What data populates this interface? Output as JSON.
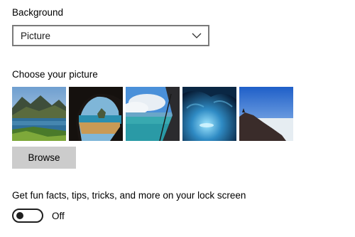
{
  "background": {
    "label": "Background",
    "selected": "Picture"
  },
  "picture_chooser": {
    "label": "Choose your picture",
    "thumbnails": [
      {
        "name": "mountain-lake"
      },
      {
        "name": "beach-cave"
      },
      {
        "name": "tent-coast"
      },
      {
        "name": "ice-cave"
      },
      {
        "name": "hill-sky"
      }
    ]
  },
  "browse_label": "Browse",
  "lock_screen": {
    "tips_label": "Get fun facts, tips, tricks, and more on your lock screen",
    "toggle_state": "Off"
  }
}
